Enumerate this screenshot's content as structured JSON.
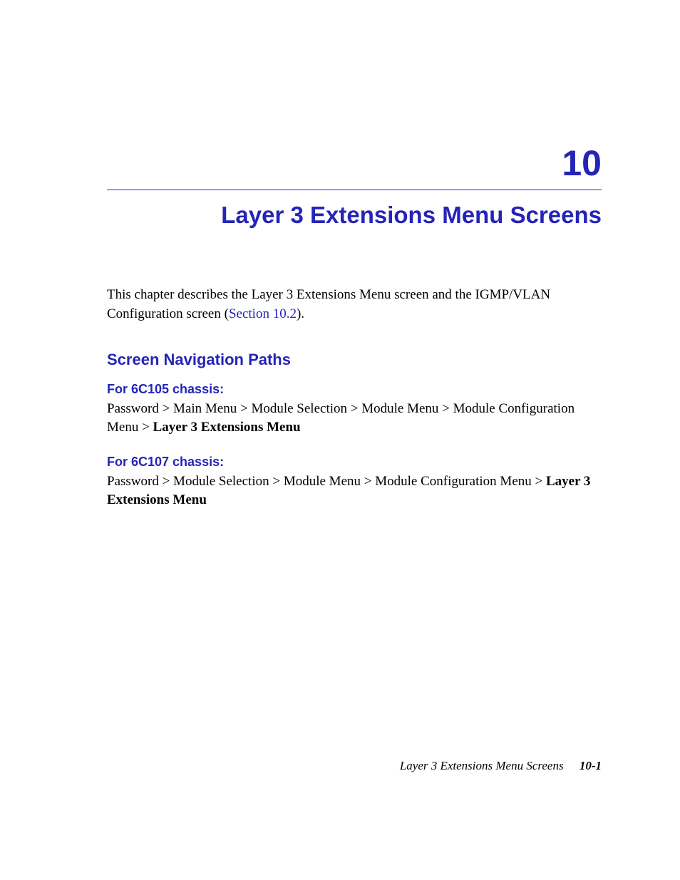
{
  "chapter": {
    "number": "10",
    "title": "Layer 3 Extensions Menu Screens"
  },
  "intro": {
    "text_before_link": "This chapter describes the Layer 3 Extensions Menu screen and the IGMP/VLAN Configuration screen (",
    "link_text": "Section 10.2",
    "text_after_link": ")."
  },
  "section_heading": "Screen Navigation Paths",
  "paths": {
    "chassis_1": {
      "heading": "For 6C105 chassis:",
      "prefix": "Password > Main Menu > Module Selection > Module Menu > Module Configuration Menu > ",
      "bold_part": "Layer 3 Extensions Menu"
    },
    "chassis_2": {
      "heading": "For 6C107 chassis:",
      "prefix": "Password > Module Selection > Module Menu > Module Configuration Menu > ",
      "bold_part": "Layer 3 Extensions Menu"
    }
  },
  "footer": {
    "chapter_name": "Layer 3 Extensions Menu Screens",
    "page_number": "10-1"
  }
}
